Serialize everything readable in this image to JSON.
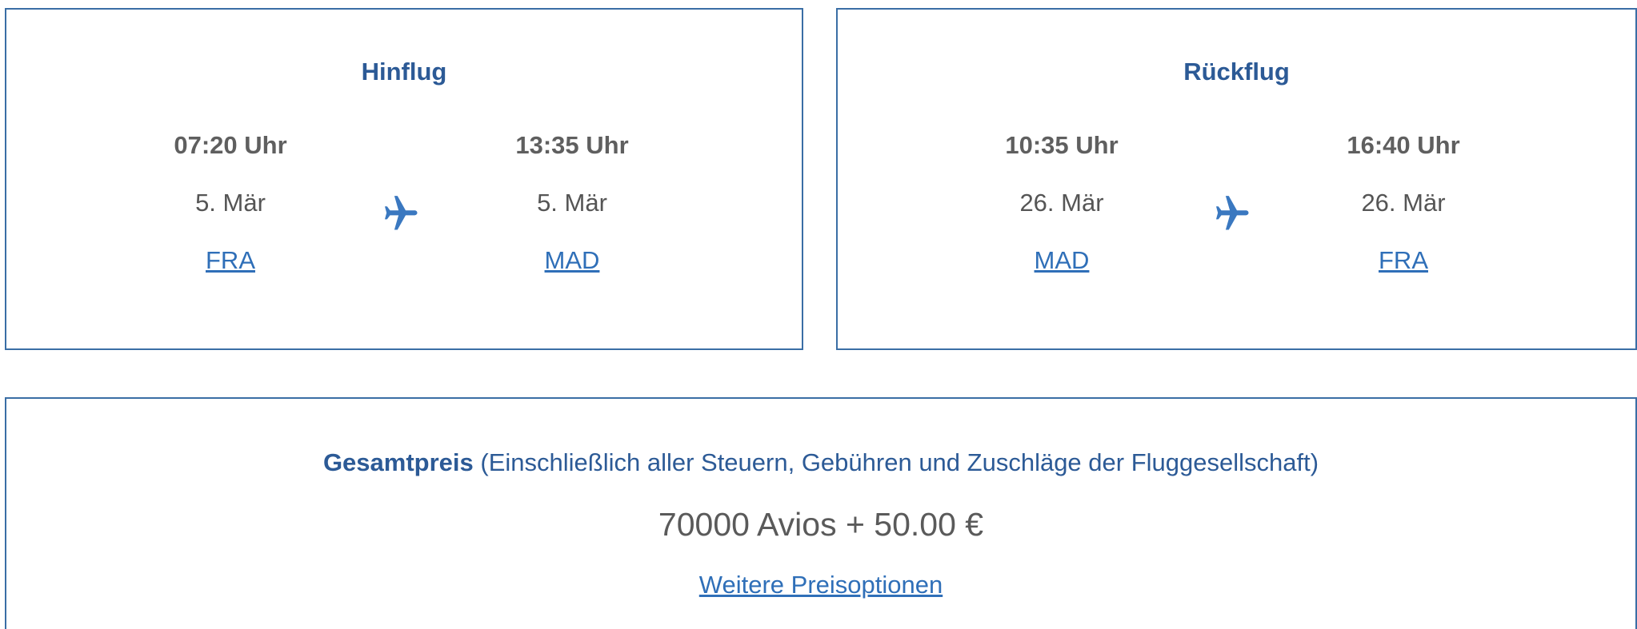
{
  "outbound": {
    "title": "Hinflug",
    "departure": {
      "time": "07:20 Uhr",
      "date": "5. Mär",
      "airport": "FRA"
    },
    "arrival": {
      "time": "13:35 Uhr",
      "date": "5. Mär",
      "airport": "MAD"
    },
    "icon": "airplane-icon"
  },
  "return": {
    "title": "Rückflug",
    "departure": {
      "time": "10:35 Uhr",
      "date": "26. Mär",
      "airport": "MAD"
    },
    "arrival": {
      "time": "16:40 Uhr",
      "date": "26. Mär",
      "airport": "FRA"
    },
    "icon": "airplane-icon"
  },
  "price": {
    "label": "Gesamtpreis",
    "note": " (Einschließlich aller Steuern, Gebühren und Zuschläge der Fluggesellschaft)",
    "amount": "70000 Avios + 50.00 €",
    "more_link": "Weitere Preisoptionen"
  },
  "colors": {
    "border": "#3a6ea5",
    "heading": "#2c5a96",
    "link": "#2f6fb8",
    "text": "#5f5f5f"
  }
}
